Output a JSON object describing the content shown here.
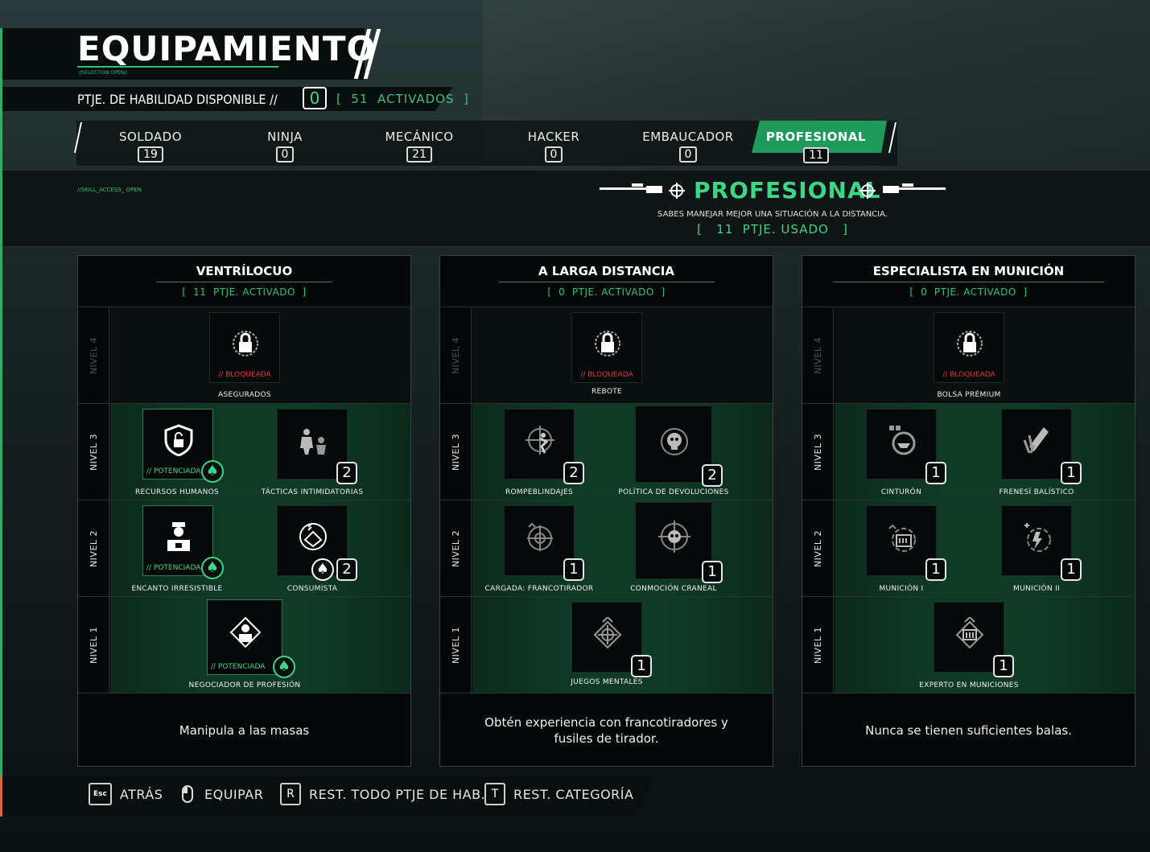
{
  "header": {
    "title": "EQUIPAMIENTO",
    "subtitle": "//SELECTION OPEN//",
    "points_label": "PTJE. DE HABILIDAD DISPONIBLE //",
    "points_value": "0",
    "activated_text": "[  51  ACTIVADOS  ]"
  },
  "tabs": [
    {
      "label": "SOLDADO",
      "count": "19"
    },
    {
      "label": "NINJA",
      "count": "0"
    },
    {
      "label": "MECÁNICO",
      "count": "21"
    },
    {
      "label": "HACKER",
      "count": "0"
    },
    {
      "label": "EMBAUCADOR",
      "count": "0"
    },
    {
      "label": "PROFESIONAL",
      "count": "11"
    }
  ],
  "active_tab": "PROFESIONAL",
  "category": {
    "access_text": "//SKILL_ACCESS_ OPEN",
    "title": "PROFESIONAL",
    "description": "SABES MANEJAR MEJOR UNA SITUACIÓN A LA DISTANCIA.",
    "used": "[   11  PTJE. USADO   ]"
  },
  "levels": [
    "NIVEL 4",
    "NIVEL 3",
    "NIVEL 2",
    "NIVEL 1"
  ],
  "status": {
    "locked": "// BLOQUEADA",
    "boosted": "// POTENCIADA"
  },
  "panels": [
    {
      "title": "VENTRÍLOCUO",
      "sub": "[  11  PTJE. ACTIVADO  ]",
      "footer": "Manipula a las masas",
      "skills": {
        "n4": [
          {
            "name": "ASEGURADOS",
            "icon": "lock-icon"
          }
        ],
        "n3": [
          {
            "name": "RECURSOS HUMANOS",
            "icon": "shield-lock-icon"
          },
          {
            "name": "TÁCTICAS INTIMIDATORIAS",
            "icon": "intimidate-icon",
            "rank": "2"
          }
        ],
        "n2": [
          {
            "name": "ENCANTO IRRESISTIBLE",
            "icon": "officer-icon"
          },
          {
            "name": "CONSUMISTA",
            "icon": "wallet-icon",
            "rank": "2"
          }
        ],
        "n1": [
          {
            "name": "NEGOCIADOR DE PROFESIÓN",
            "icon": "negotiator-icon"
          }
        ]
      }
    },
    {
      "title": "A LARGA DISTANCIA",
      "sub": "[  0  PTJE. ACTIVADO  ]",
      "footer": "Obtén experiencia con francotiradores y fusiles de tirador.",
      "skills": {
        "n4": [
          {
            "name": "REBOTE",
            "icon": "lock-icon"
          }
        ],
        "n3": [
          {
            "name": "ROMPEBLINDAJES",
            "icon": "crosshair-runner-icon",
            "rank": "2"
          },
          {
            "name": "POLÍTICA DE DEVOLUCIONES",
            "icon": "skull-icon",
            "rank": "2"
          }
        ],
        "n2": [
          {
            "name": "CARGADA: FRANCOTIRADOR",
            "icon": "reload-crosshair-icon",
            "rank": "1"
          },
          {
            "name": "CONMOCIÓN CRANEAL",
            "icon": "skull-crosshair-icon",
            "rank": "1"
          }
        ],
        "n1": [
          {
            "name": "JUEGOS MENTALES",
            "icon": "diamond-crosshair-icon",
            "rank": "1"
          }
        ]
      }
    },
    {
      "title": "ESPECIALISTA EN MUNICIÓN",
      "sub": "[  0  PTJE. ACTIVADO  ]",
      "footer": "Nunca se tienen suficientes balas.",
      "skills": {
        "n4": [
          {
            "name": "BOLSA PRÉMIUM",
            "icon": "lock-icon"
          }
        ],
        "n3": [
          {
            "name": "CINTURÓN",
            "icon": "belt-icon",
            "rank": "1"
          },
          {
            "name": "FRENESÍ BALÍSTICO",
            "icon": "bullets-icon",
            "rank": "1"
          }
        ],
        "n2": [
          {
            "name": "MUNICIÓN I",
            "icon": "ammo-box-icon",
            "rank": "1"
          },
          {
            "name": "MUNICIÓN II",
            "icon": "ammo-bolt-icon",
            "rank": "1"
          }
        ],
        "n1": [
          {
            "name": "EXPERTO EN MUNICIONES",
            "icon": "ammo-diamond-icon",
            "rank": "1"
          }
        ]
      }
    }
  ],
  "footer_keys": [
    {
      "key": "Esc",
      "label": "ATRÁS"
    },
    {
      "key": "mouse",
      "label": "EQUIPAR"
    },
    {
      "key": "R",
      "label": "REST. TODO PTJE DE HAB."
    },
    {
      "key": "T",
      "label": "REST. CATEGORÍA"
    }
  ],
  "colors": {
    "accent": "#3ed686",
    "locked": "#e23a3a",
    "tab_active": "#1f9a5b"
  }
}
